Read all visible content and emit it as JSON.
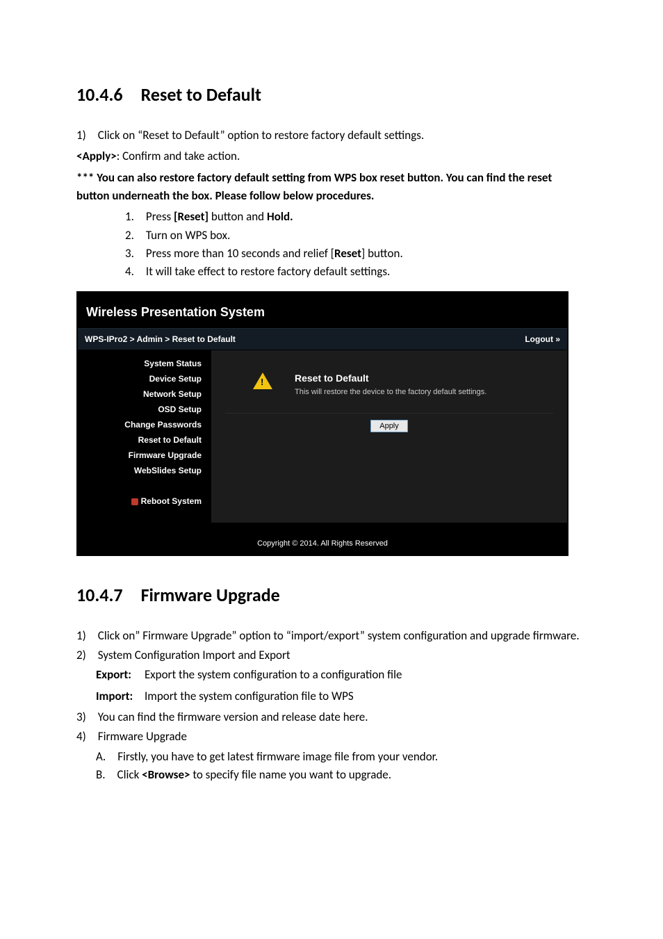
{
  "section1": {
    "heading_num": "10.4.6",
    "heading_title": "Reset to Default",
    "p1_prefix": "1) Click on “",
    "p1_link": "Reset to Default",
    "p1_suffix": "” option to restore factory default settings.",
    "p2_label": "<Apply>",
    "p2_rest": ": Confirm and take action.",
    "p3": "*** You can also restore factory default setting from WPS box reset button. You can find the reset button underneath the box. Please follow below procedures.",
    "ol": {
      "i1_a": "1. Press ",
      "i1_b": "[Reset]",
      "i1_c": " button and ",
      "i1_d": "Hold.",
      "i2": "2. Turn on WPS box.",
      "i3_a": "3. Press more than 10 seconds and relief [",
      "i3_b": "Reset",
      "i3_c": "] button.",
      "i4": "4. It will take effect to restore factory default settings."
    }
  },
  "panel": {
    "title": "Wireless Presentation System",
    "breadcrumb": "WPS-IPro2 > Admin > Reset to Default",
    "logout": "Logout »",
    "sidebar": {
      "items": [
        "System Status",
        "Device Setup",
        "Network Setup",
        "OSD Setup",
        "Change Passwords",
        "Reset to Default",
        "Firmware Upgrade",
        "WebSlides Setup"
      ],
      "reboot": "Reboot System"
    },
    "content": {
      "heading": "Reset to Default",
      "desc": "This will restore the device to the factory default settings.",
      "apply": "Apply"
    },
    "footer": "Copyright © 2014. All Rights Reserved"
  },
  "section2": {
    "heading_num": "10.4.7",
    "heading_title": "Firmware Upgrade",
    "li1": "1) Click on” Firmware Upgrade” option to “import/export” system configuration and upgrade firmware.",
    "li2": "2) System Configuration Import and Export",
    "li2a_label": "Export:",
    "li2a_rest": "Export the system configuration to a configuration file",
    "li2b_label": "Import:",
    "li2b_rest": "Import the system configuration file to WPS",
    "li3": "3) You can find the firmware version and release date here.",
    "li4": "4) Firmware Upgrade",
    "li4a": "A. Firstly, you have to get latest firmware image file from your vendor.",
    "li4b_a": "B. Click ",
    "li4b_b": "<Browse>",
    "li4b_c": " to specify file name you want to upgrade."
  }
}
